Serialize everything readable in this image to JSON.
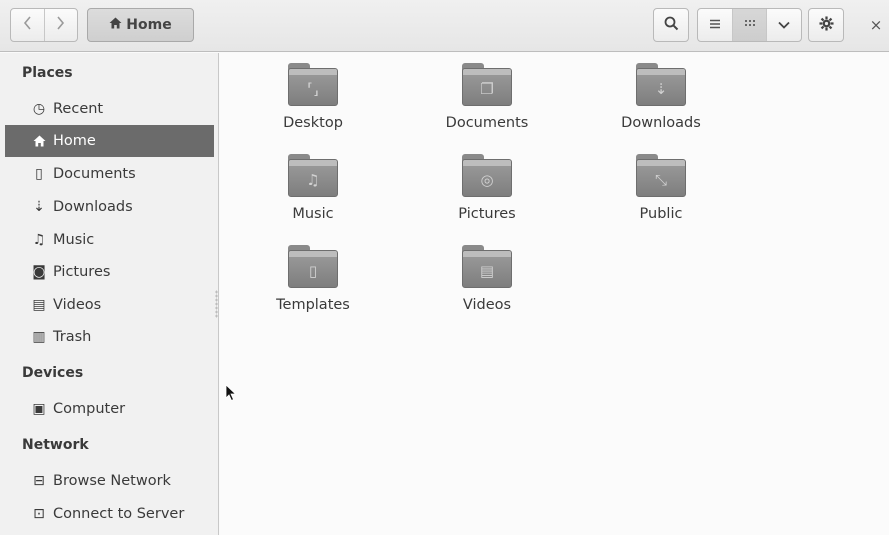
{
  "header": {
    "back_icon": "chevron-left-icon",
    "forward_icon": "chevron-right-icon",
    "path_label": "Home",
    "search_icon": "search-icon",
    "list_view_icon": "list-icon",
    "grid_view_icon": "grid-icon",
    "view_menu_icon": "chevron-down-icon",
    "settings_icon": "gear-icon",
    "close_glyph": "×"
  },
  "sidebar": {
    "places_title": "Places",
    "places": [
      {
        "label": "Recent",
        "icon": "clock-icon",
        "glyph": "◷"
      },
      {
        "label": "Home",
        "icon": "home-icon",
        "glyph": "⌂",
        "selected": true
      },
      {
        "label": "Documents",
        "icon": "document-icon",
        "glyph": "▯"
      },
      {
        "label": "Downloads",
        "icon": "download-icon",
        "glyph": "⇣"
      },
      {
        "label": "Music",
        "icon": "music-icon",
        "glyph": "♫"
      },
      {
        "label": "Pictures",
        "icon": "camera-icon",
        "glyph": "◙"
      },
      {
        "label": "Videos",
        "icon": "film-icon",
        "glyph": "▤"
      },
      {
        "label": "Trash",
        "icon": "trash-icon",
        "glyph": "▥"
      }
    ],
    "devices_title": "Devices",
    "devices": [
      {
        "label": "Computer",
        "icon": "drive-icon",
        "glyph": "▣"
      }
    ],
    "network_title": "Network",
    "network": [
      {
        "label": "Browse Network",
        "icon": "network-icon",
        "glyph": "⊟"
      },
      {
        "label": "Connect to Server",
        "icon": "server-icon",
        "glyph": "⊡"
      }
    ]
  },
  "folders": [
    {
      "label": "Desktop",
      "emblem": "⸢⸥"
    },
    {
      "label": "Documents",
      "emblem": "❐"
    },
    {
      "label": "Downloads",
      "emblem": "⇣"
    },
    {
      "label": "Music",
      "emblem": "♫"
    },
    {
      "label": "Pictures",
      "emblem": "◎"
    },
    {
      "label": "Public",
      "emblem": "⤡"
    },
    {
      "label": "Templates",
      "emblem": "▯"
    },
    {
      "label": "Videos",
      "emblem": "▤"
    }
  ]
}
